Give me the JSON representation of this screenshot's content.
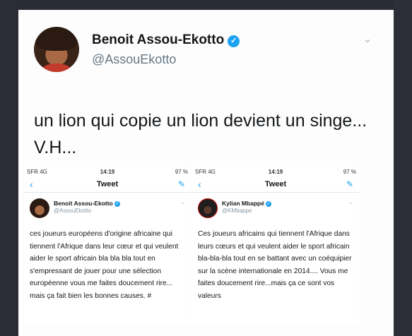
{
  "tweet": {
    "name": "Benoit Assou-Ekotto",
    "handle": "@AssouEkotto",
    "text": "un lion qui copie un lion devient un singe... V.H..."
  },
  "embedded": [
    {
      "status": {
        "carrier": "SFR 4G",
        "time": "14:19",
        "battery": "97 %"
      },
      "nav_title": "Tweet",
      "name": "Benoit Assou-Ekotto",
      "handle": "@AssouEkotto",
      "text": "ces joueurs européens d'origine africaine qui tiennent l'Afrique dans leur cœur et qui veulent aider le sport africain bla bla bla tout en s'empressant de jouer pour une sélection européenne vous me faites doucement rire... mais ça fait bien les bonnes causes. #"
    },
    {
      "status": {
        "carrier": "SFR 4G",
        "time": "14:19",
        "battery": "97 %"
      },
      "nav_title": "Tweet",
      "name": "Kylian Mbappé",
      "handle": "@KMbappe",
      "text": "Ces joueurs africains qui tiennent l'Afrique dans leurs cœurs et qui veulent aider le sport africain bla-bla-bla tout en se battant avec un coéquipier sur la scène internationale en 2014.... Vous me faites doucement rire...mais ça ce sont vos valeurs"
    }
  ]
}
